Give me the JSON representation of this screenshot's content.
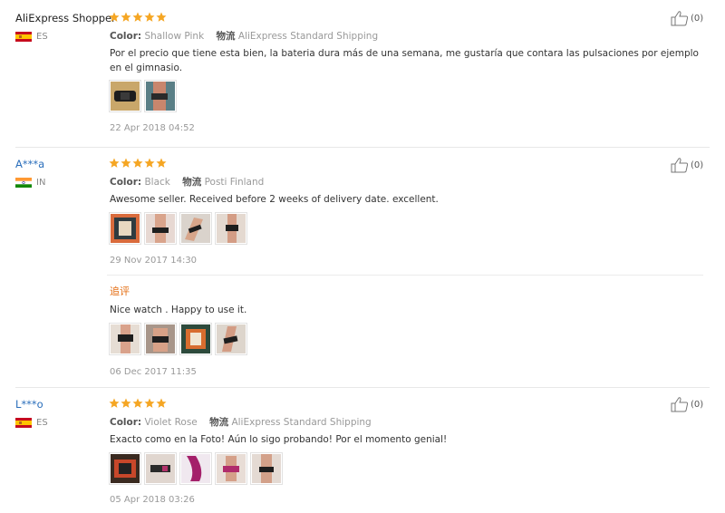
{
  "reviews": [
    {
      "user": "AliExpress Shopper",
      "country": "ES",
      "rating": 5,
      "color_label": "Color:",
      "color_value": "Shallow Pink",
      "shipping_label": "物流",
      "shipping_value": "AliExpress Standard Shipping",
      "text": "Por el precio que tiene esta bien, la bateria dura más de una semana, me gustaría que contara las pulsaciones por ejemplo en el gimnasio.",
      "photo_count": 2,
      "date": "22 Apr 2018 04:52",
      "helpful": "(0)"
    },
    {
      "user": "A***a",
      "country": "IN",
      "rating": 5,
      "color_label": "Color:",
      "color_value": "Black",
      "shipping_label": "物流",
      "shipping_value": "Posti Finland",
      "text": "Awesome seller. Received before 2 weeks of delivery date. excellent.",
      "photo_count": 4,
      "date": "29 Nov 2017 14:30",
      "helpful": "(0)",
      "append": {
        "title": "追评",
        "text": "Nice watch . Happy to use it.",
        "photo_count": 4,
        "date": "06 Dec 2017 11:35"
      }
    },
    {
      "user": "L***o",
      "country": "ES",
      "rating": 5,
      "color_label": "Color:",
      "color_value": "Violet Rose",
      "shipping_label": "物流",
      "shipping_value": "AliExpress Standard Shipping",
      "text": "Exacto como en la Foto! Aún lo sigo probando! Por el momento genial!",
      "photo_count": 5,
      "date": "05 Apr 2018 03:26",
      "helpful": "(0)"
    }
  ],
  "colors": {
    "star": "#f5a623",
    "link": "#2a6ebb",
    "append_title": "#e46d12",
    "muted": "#999999"
  },
  "icons": {
    "star": "star-icon",
    "helpful": "thumbs-up-icon",
    "flag_es": "flag-spain-icon",
    "flag_in": "flag-india-icon"
  }
}
